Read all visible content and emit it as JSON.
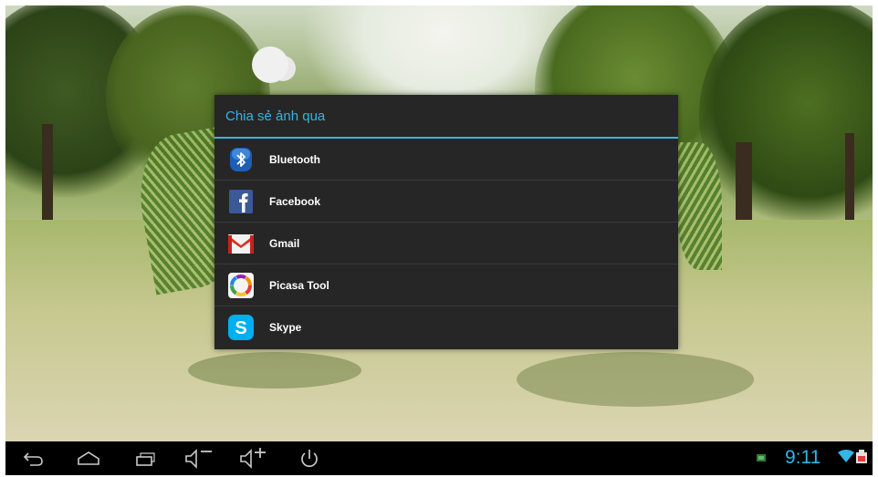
{
  "dialog": {
    "title": "Chia sẻ ảnh qua",
    "items": [
      {
        "label": "Bluetooth",
        "icon": "bluetooth-icon"
      },
      {
        "label": "Facebook",
        "icon": "facebook-icon"
      },
      {
        "label": "Gmail",
        "icon": "gmail-icon"
      },
      {
        "label": "Picasa Tool",
        "icon": "picasa-icon"
      },
      {
        "label": "Skype",
        "icon": "skype-icon"
      }
    ]
  },
  "navbar": {
    "buttons": [
      "back-icon",
      "home-icon",
      "recent-apps-icon",
      "volume-down-icon",
      "volume-up-icon",
      "power-icon"
    ],
    "clock": "9:11",
    "status_icons": [
      "notification-icon",
      "wifi-icon",
      "battery-icon"
    ]
  },
  "colors": {
    "accent": "#33b5e5",
    "dialog_bg": "#262626",
    "navbar_bg": "#000000"
  }
}
